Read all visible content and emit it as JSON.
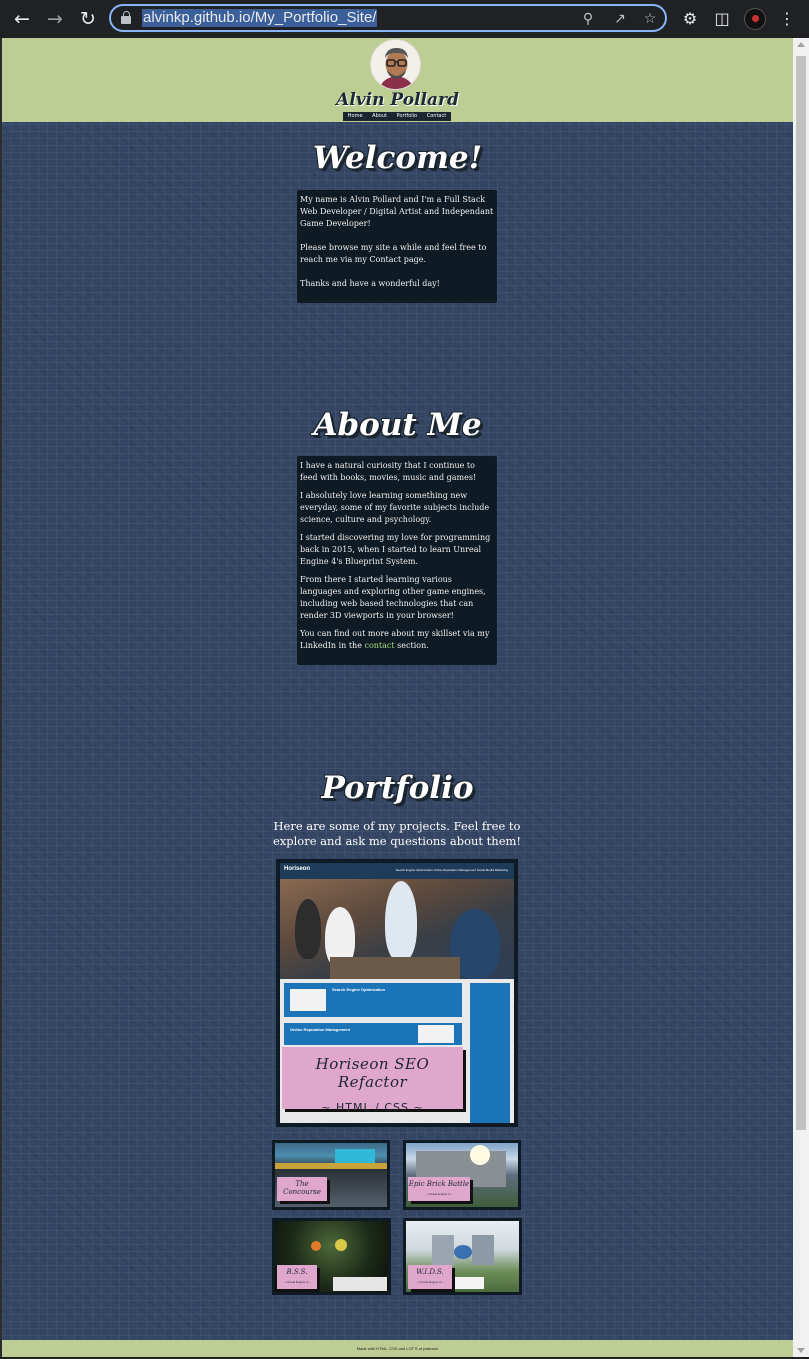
{
  "browser": {
    "url": "alvinkp.github.io/My_Portfolio_Site/",
    "back_icon": "back-arrow-icon",
    "forward_icon": "forward-arrow-icon",
    "reload_icon": "reload-icon"
  },
  "header": {
    "name": "Alvin Pollard",
    "nav": [
      "Home",
      "About",
      "Portfolio",
      "Contact"
    ]
  },
  "welcome": {
    "title": "Welcome!",
    "paragraphs": [
      "My name is Alvin Pollard and I'm a Full Stack Web Developer / Digital Artist and Independant Game Developer!",
      "Please browse my site a while and feel free to reach me via my Contact page.",
      "Thanks and have a wonderful day!"
    ]
  },
  "about": {
    "title": "About Me",
    "paragraphs": [
      "I have a natural curiosity that I continue to feed with books, movies, music and games!",
      "I absolutely love learning something new everyday, some of my favorite subjects include science, culture and psychology.",
      "I started discovering my love for programming back in 2015, when I started to learn Unreal Engine 4's Blueprint System.",
      "From there I started learning various languages and exploring other game engines, including web based technologies that can render 3D viewports in your browser!"
    ],
    "last_before": "You can find out more about my skillset via my LinkedIn in the ",
    "last_link": "contact",
    "last_after": " section."
  },
  "portfolio": {
    "title": "Portfolio",
    "intro": "Here are some of my projects. Feel free to explore and ask me questions about them!",
    "featured": {
      "title": "Horiseon SEO Refactor",
      "subtitle": "~ HTML / CSS ~",
      "shot_brand": "Horiseon",
      "shot_nav": "Search Engine Optimization    Online Reputation Management    Social Media Marketing",
      "shot_sec1": "Search Engine Optimization",
      "shot_sec2": "Online Reputation Management"
    },
    "projects": [
      {
        "title": "The Concourse",
        "subtitle": "~ Unreal Engine 4 ~"
      },
      {
        "title": "Epic Brick Battle",
        "subtitle": "~ Unreal Engine 4 ~"
      },
      {
        "title": "B.S.S.",
        "subtitle": "~ Unreal Engine 4 ~"
      },
      {
        "title": "W.I.D.S.",
        "subtitle": "~ Unreal Engine 4 ~"
      }
    ]
  },
  "footer": {
    "text": "Made with HTML, CSS and LOT'S of patience"
  },
  "colors": {
    "header_bg": "#becd94",
    "page_bg": "#344663",
    "box_bg": "#0f1b24",
    "label_pink": "#e0a7cc",
    "link_green": "#a9d77b"
  }
}
